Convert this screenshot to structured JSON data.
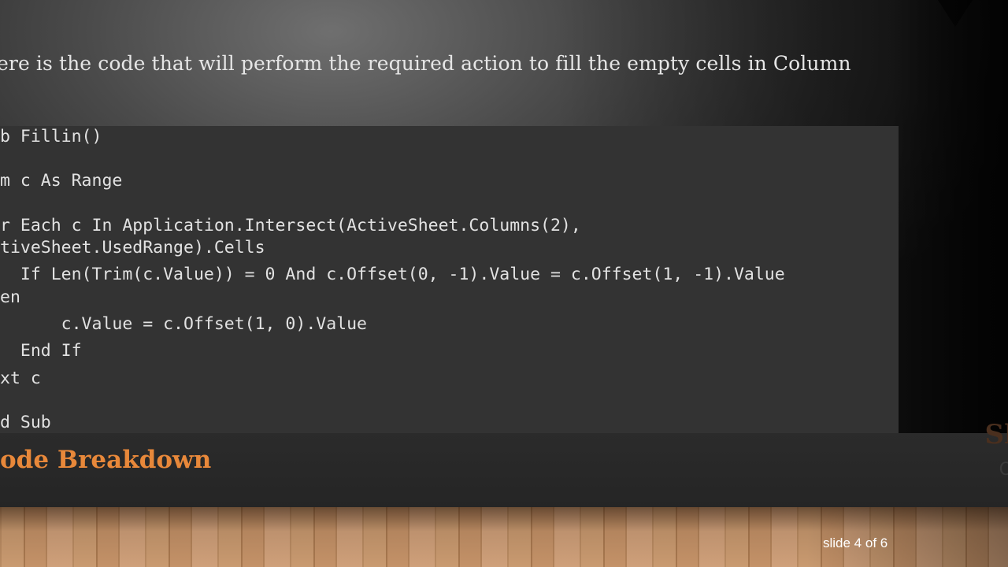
{
  "slide": {
    "intro": "ere is the code that will perform the required action to fill the empty cells in Column",
    "code_lines": [
      "b Fillin()",
      "m c As Range",
      "r Each c In Application.Intersect(ActiveSheet.Columns(2),",
      "tiveSheet.UsedRange).Cells",
      "  If Len(Trim(c.Value)) = 0 And c.Offset(0, -1).Value = c.Offset(1, -1).Value",
      "en",
      "      c.Value = c.Offset(1, 0).Value",
      "  End If",
      "xt c",
      "d Sub"
    ],
    "title": "ode Breakdown",
    "ghost_title": "Sl",
    "ghost_sub": "O",
    "counter": "slide 4 of 6"
  },
  "colors": {
    "title": "#e8883a",
    "code_panel": "#333333",
    "code_text": "#e2e2e2"
  }
}
